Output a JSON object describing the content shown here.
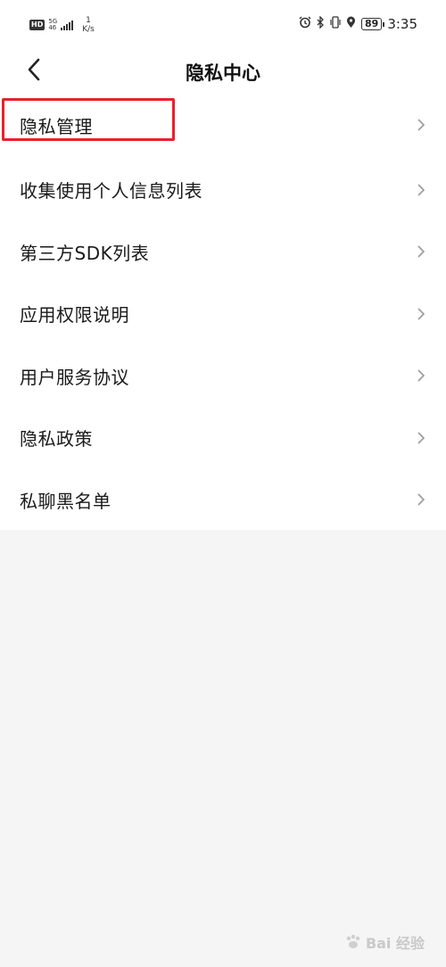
{
  "status_bar": {
    "hd": "HD",
    "network_top": "5G",
    "network_bottom": "46",
    "speed_value": "1",
    "speed_unit": "K/s",
    "battery": "89",
    "time": "3:35",
    "icons": [
      "alarm-icon",
      "bluetooth-icon",
      "vibrate-icon",
      "location-icon",
      "battery-icon"
    ]
  },
  "nav": {
    "title": "隐私中心",
    "back_icon": "chevron-left-icon"
  },
  "menu": {
    "items": [
      {
        "label": "隐私管理"
      },
      {
        "label": "收集使用个人信息列表"
      },
      {
        "label": "第三方SDK列表"
      },
      {
        "label": "应用权限说明"
      },
      {
        "label": "用户服务协议"
      },
      {
        "label": "隐私政策"
      },
      {
        "label": "私聊黑名单"
      }
    ]
  },
  "annotation": {
    "color": "#e8222a"
  },
  "watermark": {
    "text": "Bai 经验"
  }
}
